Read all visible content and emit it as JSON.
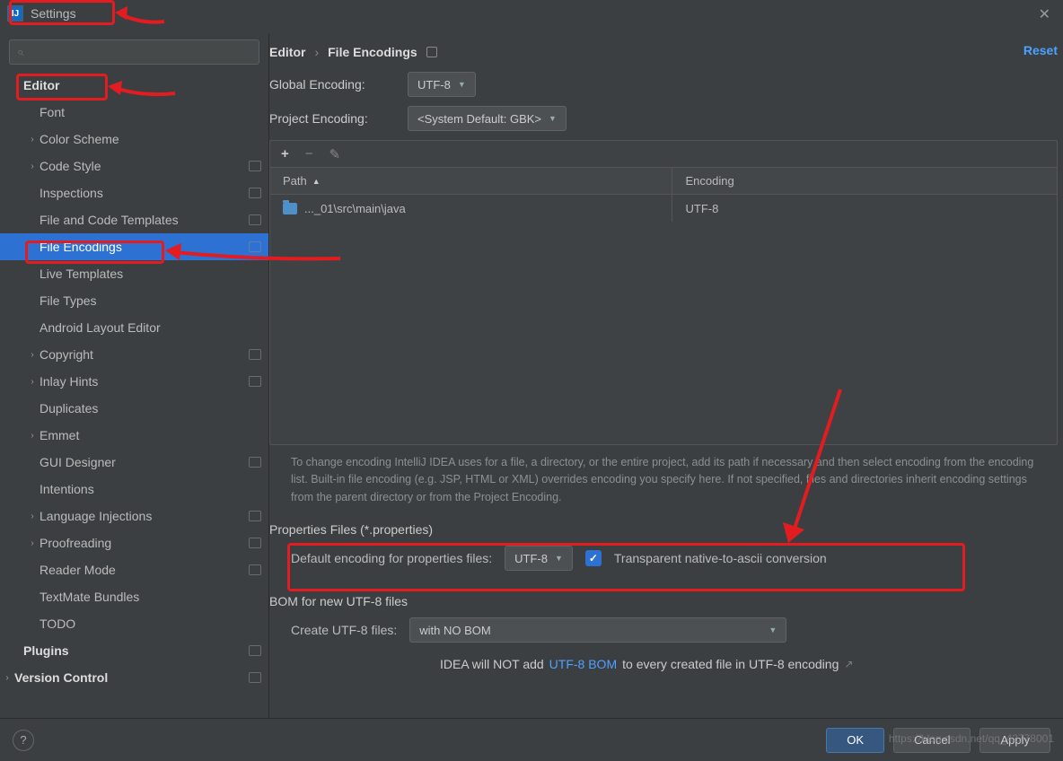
{
  "window": {
    "title": "Settings",
    "close_glyph": "✕"
  },
  "search": {
    "icon": "⌕",
    "placeholder": ""
  },
  "sidebar": [
    {
      "label": "Editor",
      "depth": 1,
      "chev": false,
      "badge": false,
      "bold": true
    },
    {
      "label": "Font",
      "depth": 2,
      "chev": false,
      "badge": false
    },
    {
      "label": "Color Scheme",
      "depth": 2,
      "chev": true,
      "badge": false
    },
    {
      "label": "Code Style",
      "depth": 2,
      "chev": true,
      "badge": true
    },
    {
      "label": "Inspections",
      "depth": 2,
      "chev": false,
      "badge": true
    },
    {
      "label": "File and Code Templates",
      "depth": 2,
      "chev": false,
      "badge": true
    },
    {
      "label": "File Encodings",
      "depth": 2,
      "chev": false,
      "badge": true,
      "selected": true
    },
    {
      "label": "Live Templates",
      "depth": 2,
      "chev": false,
      "badge": false
    },
    {
      "label": "File Types",
      "depth": 2,
      "chev": false,
      "badge": false
    },
    {
      "label": "Android Layout Editor",
      "depth": 2,
      "chev": false,
      "badge": false
    },
    {
      "label": "Copyright",
      "depth": 2,
      "chev": true,
      "badge": true
    },
    {
      "label": "Inlay Hints",
      "depth": 2,
      "chev": true,
      "badge": true
    },
    {
      "label": "Duplicates",
      "depth": 2,
      "chev": false,
      "badge": false
    },
    {
      "label": "Emmet",
      "depth": 2,
      "chev": true,
      "badge": false
    },
    {
      "label": "GUI Designer",
      "depth": 2,
      "chev": false,
      "badge": true
    },
    {
      "label": "Intentions",
      "depth": 2,
      "chev": false,
      "badge": false
    },
    {
      "label": "Language Injections",
      "depth": 2,
      "chev": true,
      "badge": true
    },
    {
      "label": "Proofreading",
      "depth": 2,
      "chev": true,
      "badge": true
    },
    {
      "label": "Reader Mode",
      "depth": 2,
      "chev": false,
      "badge": true
    },
    {
      "label": "TextMate Bundles",
      "depth": 2,
      "chev": false,
      "badge": false
    },
    {
      "label": "TODO",
      "depth": 2,
      "chev": false,
      "badge": false
    },
    {
      "label": "Plugins",
      "depth": 1,
      "chev": false,
      "badge": true,
      "bold": true
    },
    {
      "label": "Version Control",
      "depth": 1,
      "chev": true,
      "badge": true,
      "bold": true,
      "chevDepth": 0
    }
  ],
  "breadcrumb": {
    "root": "Editor",
    "sep": "›",
    "leaf": "File Encodings"
  },
  "reset": "Reset",
  "globalEnc": {
    "label": "Global Encoding:",
    "value": "UTF-8"
  },
  "projectEnc": {
    "label": "Project Encoding:",
    "value": "<System Default: GBK>"
  },
  "toolbar": {
    "add": "+",
    "remove": "−",
    "edit": "✎"
  },
  "table": {
    "col1": "Path",
    "col2": "Encoding",
    "rows": [
      {
        "path": "..._01\\src\\main\\java",
        "encoding": "UTF-8"
      }
    ]
  },
  "helpText": "To change encoding IntelliJ IDEA uses for a file, a directory, or the entire project, add its path if necessary and then select encoding from the encoding list. Built-in file encoding (e.g. JSP, HTML or XML) overrides encoding you specify here. If not specified, files and directories inherit encoding settings from the parent directory or from the Project Encoding.",
  "propSection": {
    "title": "Properties Files (*.properties)",
    "label": "Default encoding for properties files:",
    "value": "UTF-8",
    "checkboxLabel": "Transparent native-to-ascii conversion",
    "checked": true
  },
  "bomSection": {
    "title": "BOM for new UTF-8 files",
    "label": "Create UTF-8 files:",
    "value": "with NO BOM",
    "notePrefix": "IDEA will NOT add ",
    "noteLink": "UTF-8 BOM",
    "noteSuffix": " to every created file in UTF-8 encoding",
    "extGlyph": "↗"
  },
  "footer": {
    "ok": "OK",
    "cancel": "Cancel",
    "apply": "Apply",
    "help": "?"
  },
  "watermark": "https://blog.csdn.net/qq_42778001"
}
